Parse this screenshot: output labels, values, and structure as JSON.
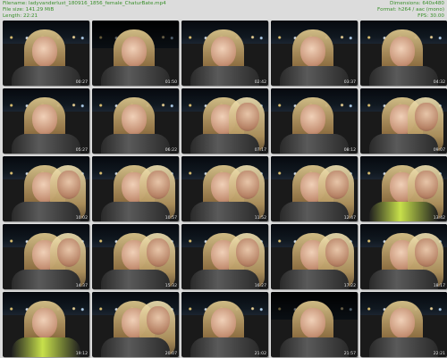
{
  "header": {
    "left": {
      "filename_label": "Filename: ladyvanderlust_180916_1856_female_ChaturBate.mp4",
      "filesize_label": "File size: 141.29 MiB",
      "length_label": "Length: 22:21"
    },
    "right": {
      "dimensions_label": "Dimensions: 640x480",
      "format_label": "Format: h264 / aac (mono)",
      "fps_label": "FPS: 30.00"
    }
  },
  "thumbnails": [
    {
      "ts": "00:27",
      "variant": "one"
    },
    {
      "ts": "01:50",
      "variant": "dark"
    },
    {
      "ts": "02:42",
      "variant": "one"
    },
    {
      "ts": "03:37",
      "variant": "one"
    },
    {
      "ts": "04:32",
      "variant": "one"
    },
    {
      "ts": "05:27",
      "variant": "one"
    },
    {
      "ts": "06:22",
      "variant": "one"
    },
    {
      "ts": "07:17",
      "variant": "two"
    },
    {
      "ts": "08:12",
      "variant": "one"
    },
    {
      "ts": "09:07",
      "variant": "two"
    },
    {
      "ts": "10:02",
      "variant": "two"
    },
    {
      "ts": "10:57",
      "variant": "two"
    },
    {
      "ts": "11:52",
      "variant": "two"
    },
    {
      "ts": "12:47",
      "variant": "two"
    },
    {
      "ts": "13:42",
      "variant": "two",
      "lime": true
    },
    {
      "ts": "14:37",
      "variant": "two"
    },
    {
      "ts": "15:32",
      "variant": "two"
    },
    {
      "ts": "16:27",
      "variant": "two"
    },
    {
      "ts": "17:22",
      "variant": "two"
    },
    {
      "ts": "18:17",
      "variant": "two"
    },
    {
      "ts": "19:12",
      "variant": "one",
      "lime": true
    },
    {
      "ts": "20:07",
      "variant": "two"
    },
    {
      "ts": "21:02",
      "variant": "one"
    },
    {
      "ts": "21:57",
      "variant": "dark"
    },
    {
      "ts": "22:21",
      "variant": "one"
    }
  ]
}
